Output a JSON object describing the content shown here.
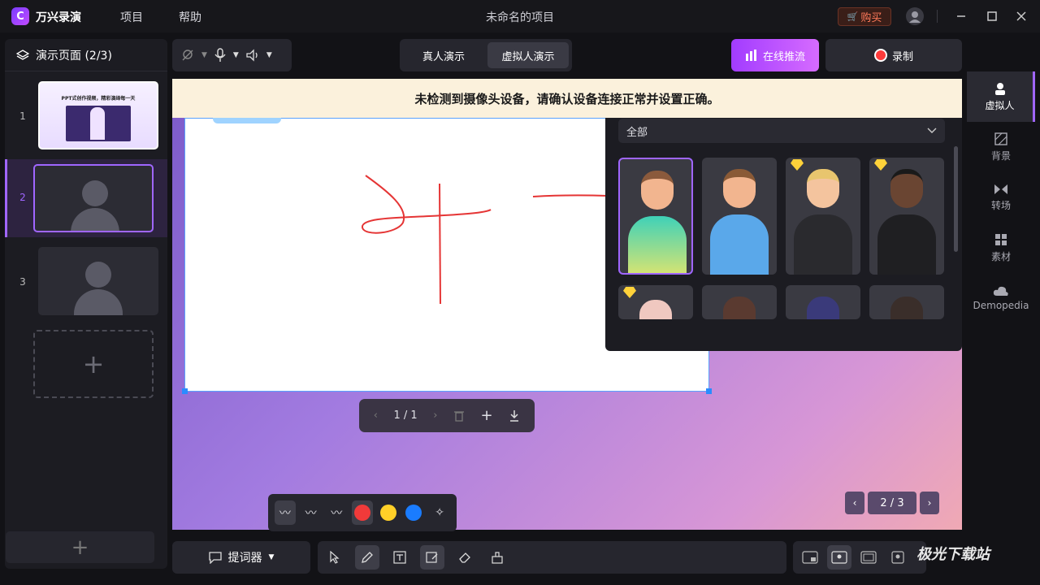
{
  "titlebar": {
    "app_name": "万兴录演",
    "menu": [
      "项目",
      "帮助"
    ],
    "project_title": "未命名的项目",
    "buy_label": "购买"
  },
  "left_panel": {
    "header": "演示页面 (2/3)",
    "slides": [
      {
        "number": "1",
        "thumb_title": "PPT式创作视频，精彩演绎每一天"
      },
      {
        "number": "2"
      },
      {
        "number": "3"
      }
    ],
    "add_label": "+"
  },
  "toolbar": {
    "mode_tabs": [
      "真人演示",
      "虚拟人演示"
    ],
    "active_mode": "虚拟人演示",
    "stream_label": "在线推流",
    "record_label": "录制"
  },
  "warning": "未检测到摄像头设备，请确认设备连接正常并设置正确。",
  "whiteboard": {
    "page_indicator": "1 / 1",
    "stroke_color": "#e53535"
  },
  "slide_nav": {
    "indicator": "2 / 3"
  },
  "avatar_panel": {
    "filter_label": "全部",
    "avatars": [
      "avatar-1",
      "avatar-2",
      "avatar-3",
      "avatar-4",
      "avatar-5",
      "avatar-6",
      "avatar-7",
      "avatar-8"
    ]
  },
  "right_sidebar": {
    "items": [
      {
        "label": "虚拟人",
        "icon": "person-icon"
      },
      {
        "label": "背景",
        "icon": "background-icon"
      },
      {
        "label": "转场",
        "icon": "transition-icon"
      },
      {
        "label": "素材",
        "icon": "material-icon"
      },
      {
        "label": "Demopedia",
        "icon": "cloud-icon"
      }
    ]
  },
  "palette": {
    "colors": [
      "#f03a3a",
      "#ffd028",
      "#1a7cff"
    ]
  },
  "bottom": {
    "prompter_label": "提词器"
  },
  "watermark": "极光下载站"
}
